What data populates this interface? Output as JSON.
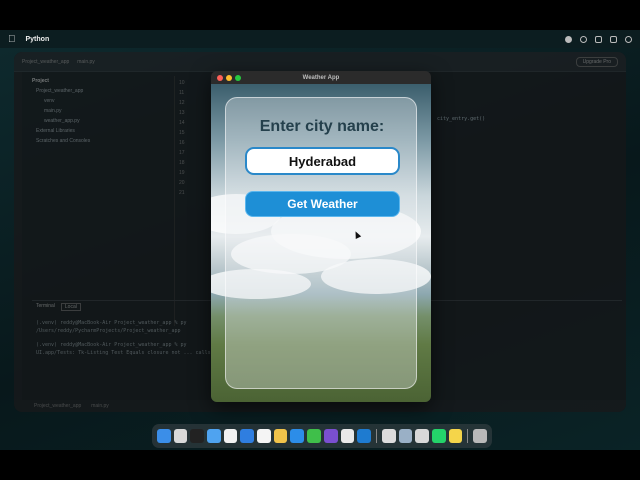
{
  "menubar": {
    "app_name": "Python"
  },
  "ide": {
    "title_left": "Project_weather_app",
    "title_file": "main.py",
    "upgrade_label": "Upgrade Pro",
    "project_header": "Project",
    "tree": [
      "Project_weather_app",
      "venv",
      "main.py",
      "weather_app.py",
      "External Libraries",
      "Scratches and Consoles"
    ],
    "line_numbers": [
      "10",
      "11",
      "12",
      "13",
      "14",
      "15",
      "16",
      "17",
      "18",
      "19",
      "20",
      "21"
    ],
    "code_hint": "city_entry.get()",
    "terminal_tabs": [
      "Terminal",
      "Local"
    ],
    "terminal_lines": [
      "(.venv) reddy@MacBook-Air Project_weather_app % py",
      "/Users/reddy/PycharmProjects/Project_weather_app",
      "(.venv) reddy@MacBook-Air Project_weather_app % py",
      "UI.app/Tests: Tk-Listing Test Equals closure not ... calls to avoid this test."
    ],
    "status_items": [
      "Project_weather_app",
      "main.py"
    ]
  },
  "weather_app": {
    "window_title": "Weather App",
    "heading": "Enter city name:",
    "city_value": "Hyderabad",
    "button_label": "Get Weather"
  },
  "colors": {
    "button_bg": "#1e8fd6",
    "input_border": "#2a88c9",
    "heading_text": "#24404c"
  }
}
